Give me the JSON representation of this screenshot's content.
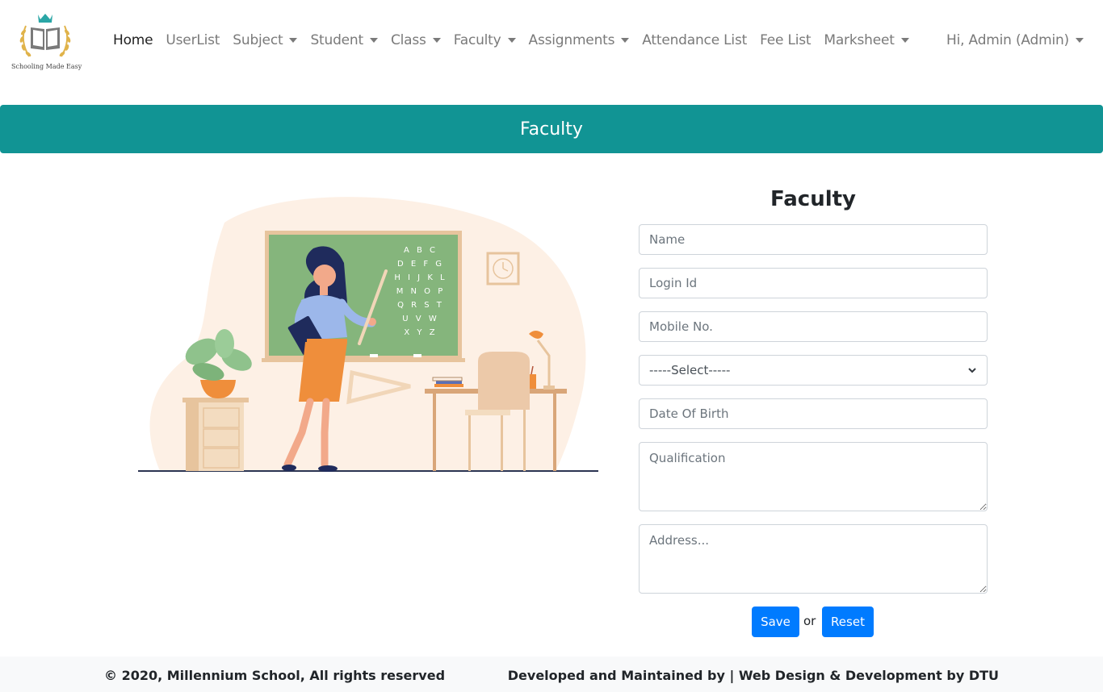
{
  "brand": {
    "tagline": "Schooling Made Easy",
    "accent_color": "#119494",
    "primary_button_color": "#007bff",
    "logo_icon": "open-book-crown-laurel-icon"
  },
  "nav": {
    "items": [
      {
        "label": "Home",
        "dropdown": false,
        "active": true
      },
      {
        "label": "UserList",
        "dropdown": false,
        "active": false
      },
      {
        "label": "Subject",
        "dropdown": true,
        "active": false
      },
      {
        "label": "Student",
        "dropdown": true,
        "active": false
      },
      {
        "label": "Class",
        "dropdown": true,
        "active": false
      },
      {
        "label": "Faculty",
        "dropdown": true,
        "active": false
      },
      {
        "label": "Assignments",
        "dropdown": true,
        "active": false
      },
      {
        "label": "Attendance List",
        "dropdown": false,
        "active": false
      },
      {
        "label": "Fee List",
        "dropdown": false,
        "active": false
      },
      {
        "label": "Marksheet",
        "dropdown": true,
        "active": false
      }
    ],
    "user_label": "Hi, Admin (Admin)"
  },
  "banner": {
    "title": "Faculty"
  },
  "illustration": {
    "board_letters": [
      "A B C",
      "D E F G",
      "H I J K L",
      "M N O P",
      "Q R S T",
      "U V W",
      "X Y Z"
    ]
  },
  "form": {
    "title": "Faculty",
    "name_placeholder": "Name",
    "login_placeholder": "Login Id",
    "mobile_placeholder": "Mobile No.",
    "select_value": "-----Select-----",
    "dob_placeholder": "Date Of Birth",
    "qualification_placeholder": "Qualification",
    "address_placeholder": "Address...",
    "save_label": "Save",
    "or_label": "or",
    "reset_label": "Reset"
  },
  "footer": {
    "left": "© 2020, Millennium School, All rights reserved",
    "right": "Developed and Maintained by | Web Design & Development by DTU"
  }
}
